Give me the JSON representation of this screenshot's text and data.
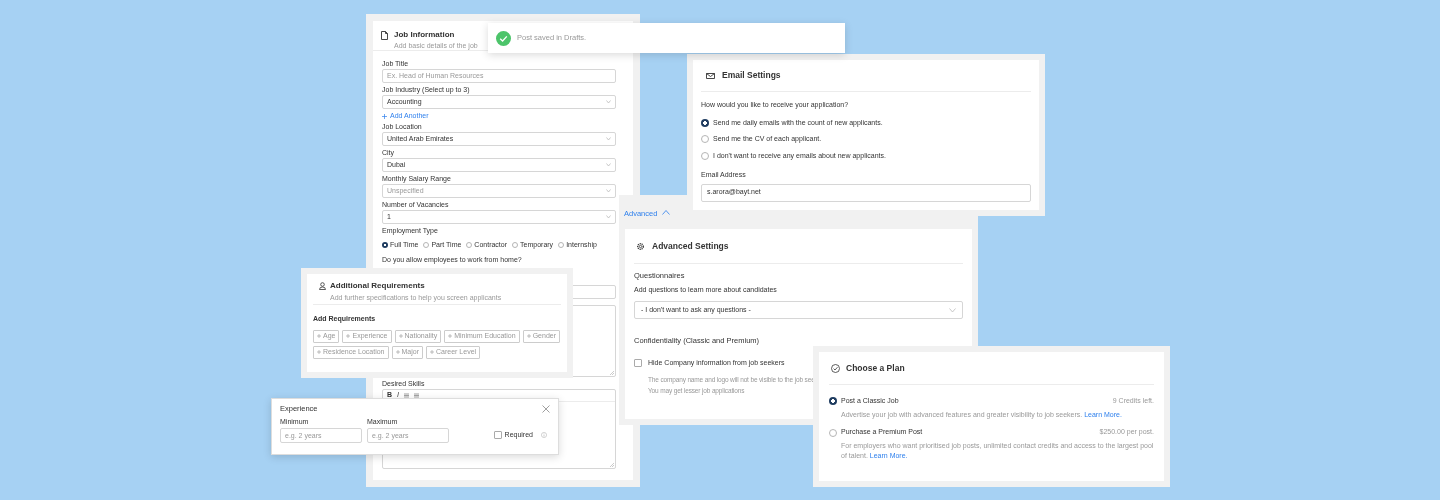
{
  "toast": {
    "message": "Post saved in Drafts."
  },
  "job_information": {
    "title": "Job Information",
    "subtitle": "Add basic details of the job",
    "fields": [
      {
        "kind": "input",
        "label": "Job Title",
        "placeholder": "Ex. Head of Human Resources"
      },
      {
        "kind": "select",
        "label": "Job Industry (Select up to 3)",
        "value": "Accounting"
      },
      {
        "kind": "link",
        "text": "Add Another"
      },
      {
        "kind": "select",
        "label": "Job Location",
        "value": "United Arab Emirates"
      },
      {
        "kind": "select",
        "label": "City",
        "value": "Dubai"
      },
      {
        "kind": "select",
        "label": "Monthly Salary Range",
        "placeholder": "Unspecified"
      },
      {
        "kind": "select",
        "label": "Number of Vacancies",
        "value": "1"
      },
      {
        "kind": "radios",
        "label": "Employment Type",
        "options": [
          {
            "label": "Full Time",
            "selected": true
          },
          {
            "label": "Part Time",
            "selected": false
          },
          {
            "label": "Contractor",
            "selected": false
          },
          {
            "label": "Temporary",
            "selected": false
          },
          {
            "label": "Internship",
            "selected": false
          }
        ]
      },
      {
        "kind": "question",
        "label": "Do you allow employees to work from home?"
      },
      {
        "kind": "input"
      },
      {
        "kind": "textarea"
      },
      {
        "kind": "editor",
        "label": "Desired Skills",
        "toolbar": [
          "B",
          "I"
        ]
      }
    ]
  },
  "email_settings": {
    "title": "Email Settings",
    "question": "How would you like to receive your application?",
    "options": [
      {
        "label": "Send me daily emails with the count of new applicants.",
        "selected": true
      },
      {
        "label": "Send me the CV of each applicant.",
        "selected": false
      },
      {
        "label": "I don't want to receive any emails about new applicants.",
        "selected": false
      }
    ],
    "email_label": "Email Address",
    "email_value": "s.arora@bayt.net"
  },
  "advanced_settings": {
    "toggle": {
      "label": "Advanced",
      "expanded": true
    },
    "title": "Advanced Settings",
    "questionnaires_heading": "Questionnaires",
    "questionnaires_hint": "Add questions to learn more about candidates",
    "questionnaire_select": "- I don't want to ask any questions -",
    "confidentiality_heading": "Confidentiality (Classic and Premium)",
    "hide_company": {
      "label": "Hide Company information from job seekers",
      "checked": false
    },
    "notes": [
      "The company name and logo will not be visible to the job see",
      "You may get lesser job applications"
    ]
  },
  "choose_plan": {
    "title": "Choose a Plan",
    "options": [
      {
        "label": "Post a Classic Job",
        "note": "9 Credits left.",
        "description": "Advertise your job with advanced features and greater visibility to job seekers.",
        "link": "Learn More.",
        "selected": true
      },
      {
        "label": "Purchase a Premium Post",
        "note": "$250.00 per post.",
        "description": "For employers who want prioritised job posts, unlimited contact credits and access to the largest pool of talent.",
        "link": "Learn More.",
        "selected": false
      }
    ]
  },
  "additional_requirements": {
    "title": "Additional Requirements",
    "subtitle": "Add further specifications to help you screen applicants",
    "heading": "Add Requirements",
    "chips": [
      "Age",
      "Experience",
      "Nationality",
      "Minimum Education",
      "Gender",
      "Residence Location",
      "Major",
      "Career Level"
    ]
  },
  "experience": {
    "title": "Experience",
    "minimum": {
      "label": "Minimum",
      "placeholder": "e.g. 2 years"
    },
    "maximum": {
      "label": "Maximum",
      "placeholder": "e.g. 2 years"
    },
    "required": {
      "label": "Required",
      "checked": false
    }
  }
}
